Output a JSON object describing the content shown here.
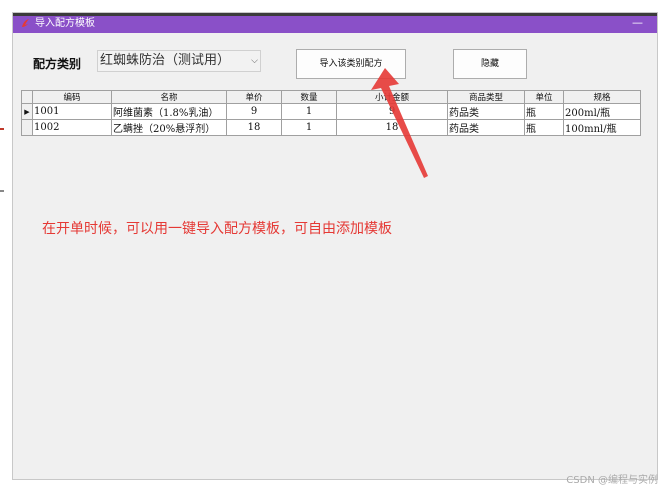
{
  "window": {
    "title": "导入配方模板",
    "minimize_glyph": "—"
  },
  "form": {
    "category_label": "配方类别",
    "category_value": "红蜘蛛防治（测试用）",
    "import_button": "导入该类别配方",
    "hide_button": "隐藏"
  },
  "table": {
    "columns": [
      "编码",
      "名称",
      "单价",
      "数量",
      "小计金额",
      "商品类型",
      "单位",
      "规格"
    ],
    "rows": [
      [
        "1001",
        "阿维菌素（1.8%乳油）",
        "9",
        "1",
        "9",
        "药品类",
        "瓶",
        "200ml/瓶"
      ],
      [
        "1002",
        "乙螨挫（20%悬浮剂）",
        "18",
        "1",
        "18",
        "药品类",
        "瓶",
        "100mnl/瓶"
      ]
    ]
  },
  "annotation": "在开单时候，可以用一键导入配方模板，可自由添加模板",
  "watermark": "CSDN @编程与实例",
  "colors": {
    "titlebar": "#8a50c8",
    "annotation": "#e53935"
  }
}
